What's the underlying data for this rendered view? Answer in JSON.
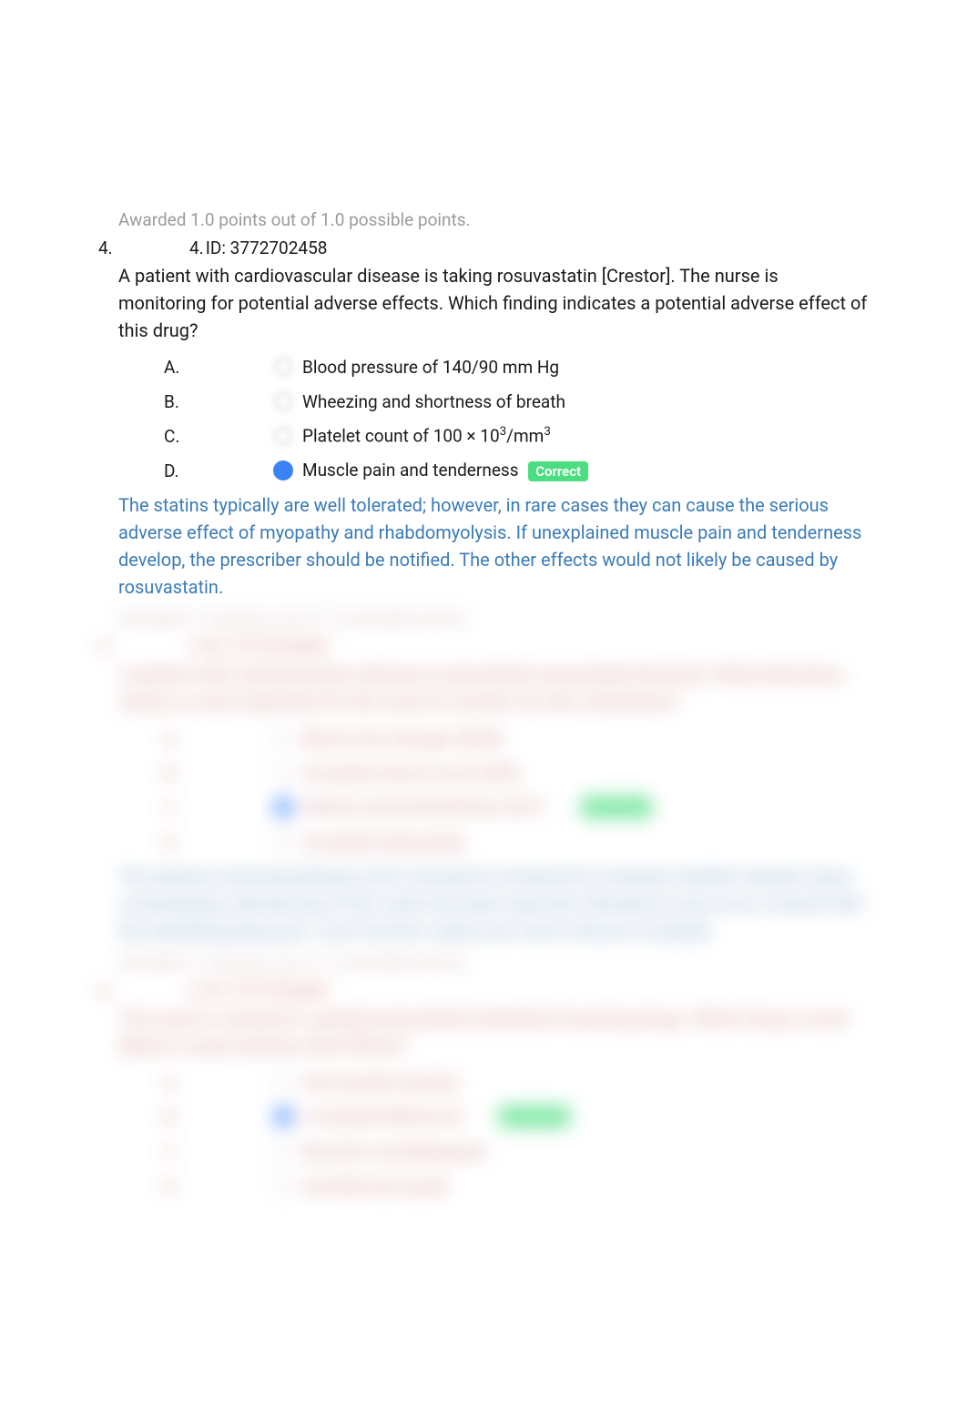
{
  "q3": {
    "points_awarded": "Awarded 1.0 points out of 1.0 possible points."
  },
  "q4": {
    "num_left": "4.",
    "num_inner": "4.",
    "id_label": "ID: 3772702458",
    "question": "A patient with cardiovascular disease is taking rosuvastatin [Crestor]. The nurse is monitoring for potential adverse effects. Which finding indicates a potential adverse effect of this drug?",
    "answers": {
      "a": {
        "letter": "A.",
        "text": "Blood pressure of 140/90 mm Hg"
      },
      "b": {
        "letter": "B.",
        "text": "Wheezing and shortness of breath"
      },
      "c": {
        "letter": "C.",
        "text_pre": "Platelet count of 100 × 10",
        "text_sup1": "3",
        "text_mid": "/mm",
        "text_sup2": "3"
      },
      "d": {
        "letter": "D.",
        "text": "Muscle pain and tenderness"
      }
    },
    "correct_label": "Correct",
    "explanation": "The statins typically are well tolerated; however, in rare cases they can cause the serious adverse effect of myopathy and rhabdomyolysis. If unexplained muscle pain and tenderness develop, the prescriber should be notified. The other effects would not likely be caused by rosuvastatin.",
    "points_awarded": "Awarded 1.0 points out of 1.0 possible points."
  },
  "q5": {
    "num_left": "5.",
    "num_inner": "5.",
    "id_label": "ID: 3772702455",
    "question": "A patient with cardiovascular disease is prescribed rosuvastatin [Crestor]. What laboratory values is most important for the nurse to monitor for this medication?",
    "answers": {
      "a": {
        "letter": "A.",
        "text": "Blood urea nitrogen (BUN)"
      },
      "b": {
        "letter": "B.",
        "text": "Complete blood count (CBC)"
      },
      "c": {
        "letter": "C.",
        "text": "Alanine aminotransferase (ALT)"
      },
      "d": {
        "letter": "D.",
        "text": "Complete lipid profile"
      }
    },
    "explanation": "The alanine aminotransferase (ALT) should be monitored to evaluate whether hepatic injury is developing. Monitoring of this value has been reported. Elevations may occur, consult with the attending physician. Liver function values are most critical to evaluate.",
    "points_awarded": "Awarded 1.0 points out of 1.0 possible points."
  },
  "q6": {
    "num_left": "6.",
    "num_inner": "6.",
    "id_label": "ID: 3772702460",
    "question": "The nurse is caring for a patient prescribed cholesterol lowering drugs. Which drug is most likely to cause adverse side effects?",
    "answers": {
      "a": {
        "letter": "A.",
        "text": "Atorvastatin [Lipitor]"
      },
      "b": {
        "letter": "B.",
        "text": "Lovastatin [Mevacor]"
      },
      "c": {
        "letter": "C.",
        "text": "Nicotinic acid [Niaspan]"
      },
      "d": {
        "letter": "D.",
        "text": "Gemfibrozil [Lopid]"
      }
    }
  }
}
